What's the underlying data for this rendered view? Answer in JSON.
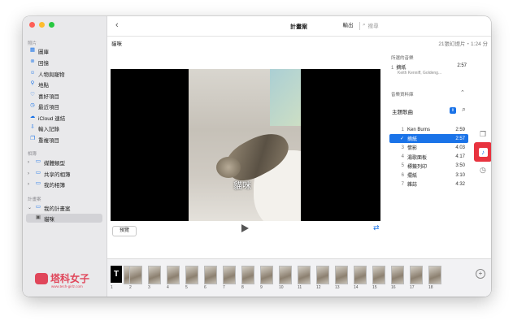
{
  "sidebar": {
    "sections": [
      {
        "label": "照片",
        "items": [
          {
            "label": "圖庫",
            "icon": "photos-icon"
          },
          {
            "label": "回憶",
            "icon": "memories-icon"
          },
          {
            "label": "人物與寵物",
            "icon": "people-icon"
          },
          {
            "label": "地點",
            "icon": "places-icon"
          },
          {
            "label": "喜好項目",
            "icon": "heart-icon"
          },
          {
            "label": "最近項目",
            "icon": "clock-icon"
          },
          {
            "label": "iCloud 連結",
            "icon": "cloud-icon"
          },
          {
            "label": "輸入記錄",
            "icon": "import-icon"
          },
          {
            "label": "重複項目",
            "icon": "duplicate-icon"
          }
        ]
      },
      {
        "label": "相簿",
        "items": [
          {
            "label": "媒體類型"
          },
          {
            "label": "共享的相簿"
          },
          {
            "label": "我的相簿"
          }
        ]
      },
      {
        "label": "計畫案",
        "items": [
          {
            "label": "我的計畫案"
          },
          {
            "label": "貓咪"
          }
        ]
      }
    ]
  },
  "toolbar": {
    "title": "計畫案",
    "export_label": "輸出",
    "search_placeholder": "搜尋"
  },
  "project": {
    "name": "貓咪",
    "info": "21張幻燈片・1:24 分"
  },
  "video": {
    "caption": "貓咪",
    "preview_label": "預覽"
  },
  "music": {
    "selected_label": "所選的音樂",
    "current": {
      "num": "1",
      "title": "摘紙",
      "artist": "Keith Kenniff, Goldeng...",
      "duration": "2:57"
    },
    "library_label": "音樂資料庫",
    "category": "主題歌曲",
    "tracks": [
      {
        "num": "1",
        "title": "Ken Burns",
        "duration": "2:59"
      },
      {
        "num": "✓",
        "title": "摘紙",
        "duration": "2:57",
        "selected": true
      },
      {
        "num": "3",
        "title": "懷影",
        "duration": "4:03"
      },
      {
        "num": "4",
        "title": "湯歌面板",
        "duration": "4:17"
      },
      {
        "num": "5",
        "title": "標籤列印",
        "duration": "3:50"
      },
      {
        "num": "6",
        "title": "擺紙",
        "duration": "3:10"
      },
      {
        "num": "7",
        "title": "雜誌",
        "duration": "4:32"
      }
    ]
  },
  "timeline": {
    "clips": [
      "1",
      "2",
      "3",
      "4",
      "5",
      "6",
      "7",
      "8",
      "9",
      "10",
      "11",
      "12",
      "13",
      "14",
      "15",
      "16",
      "17",
      "18"
    ]
  },
  "watermark": {
    "title": "塔科女子",
    "sub": "www.tech-girlz.com"
  },
  "colors": {
    "accent": "#1a73e8",
    "music_highlight": "#e8333f",
    "close": "#fe5f57",
    "minimize": "#febc2e",
    "zoom": "#28c840"
  }
}
